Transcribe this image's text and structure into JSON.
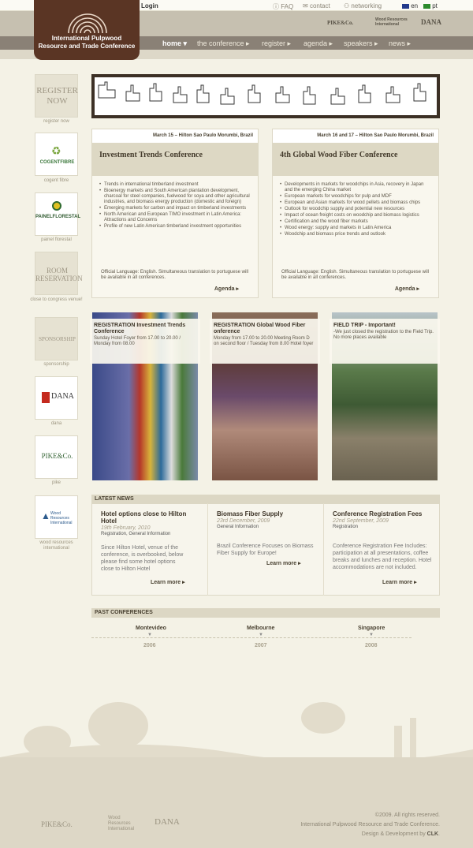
{
  "header": {
    "login": "Login",
    "faq": "FAQ",
    "contact": "contact",
    "networking": "networking",
    "lang_en": "en",
    "lang_pt": "pt",
    "logo_line1": "International Pulpwood",
    "logo_line2": "Resource and Trade Conference",
    "partner_logos": [
      "PIKE&Co.",
      "Wood Resources International",
      "DANA"
    ]
  },
  "nav": {
    "items": [
      "home",
      "the conference",
      "register",
      "agenda",
      "speakers",
      "news"
    ]
  },
  "sidebar": {
    "register_big": "REGISTER NOW",
    "register_cap": "register now",
    "cogent": "COGENTFIBRE",
    "cogent_cap": "cogent fibre",
    "painel": "PAINELFLORESTAL",
    "painel_cap": "painel florestal",
    "room_big": "ROOM RESERVATION",
    "room_cap": "close to congress venue!",
    "sponsor_big": "SPONSORSHIP",
    "sponsor_cap": "sponsorship",
    "dana": "DANA",
    "dana_cap": "dana",
    "pike": "PIKE&Co.",
    "pike_cap": "pike",
    "wri": "Wood Resources International",
    "wri_cap": "wood resources international"
  },
  "conferences": [
    {
      "date": "March 15 – Hilton Sao Paulo Morumbi, Brazil",
      "title": "Investment Trends Conference",
      "bullets": [
        "Trends in international timberland investment",
        "Bioenergy markets and South American plantation development, charcoal for steel companies, fuelwood for soya and other agricultural industries, and biomass energy production (domestic and foreign)",
        "Emerging markets for carbon and impact on timberland investments",
        "North American and European TIMO investment in Latin America: Attractions and Concerns",
        "Profile of new Latin American timberland investment opportunities"
      ],
      "lang": "Official Language: English. Simultaneous translation to portuguese will be available in all conferences.",
      "agenda": "Agenda"
    },
    {
      "date": "March 16 and 17 – Hilton Sao Paulo Morumbi, Brazil",
      "title": "4th Global Wood Fiber Conference",
      "bullets": [
        "Developments in markets for woodchips in Asia, recovery in Japan and the emerging China market",
        "European markets for woodchips for pulp and MDF",
        "European and Asian markets for wood pellets and biomass chips",
        "Outlook for woodchip supply and potential new resources",
        "Impact of ocean freight costs on woodchip and biomass logistics",
        "Certification and the wood fiber markets",
        "Wood energy: supply and markets in Latin America",
        "Woodchip and biomass price trends and outlook"
      ],
      "lang": "Official Language: English. Simultaneous translation to portuguese will be available in all conferences.",
      "agenda": "Agenda"
    }
  ],
  "tiles": [
    {
      "title": "REGISTRATION Investment Trends Conference",
      "sub": "Sunday Hotel Foyer from 17.00 to 20.00 / Monday from 08.00"
    },
    {
      "title": "REGISTRATION Global Wood Fiber onference",
      "sub": "Monday from 17.00 to 20.00 Meeting Room D on second floor / Tuesday from 8.00 Hotel foyer"
    },
    {
      "title": "FIELD TRIP - Important!",
      "sub": "-We just closed the registration to the Field Trip. No more places available"
    }
  ],
  "news": {
    "heading": "LATEST NEWS",
    "items": [
      {
        "title": "Hotel options close to Hilton Hotel",
        "date": "19th February, 2010",
        "cat": "Registration, General Information",
        "text": "Since Hilton Hotel, venue of the conference, is overbooked, below please find some hotel options close to Hilton Hotel",
        "more": "Learn more"
      },
      {
        "title": "Biomass Fiber Supply",
        "date": "23rd December, 2009",
        "cat": "General Information",
        "text": "Brazil Conference Focuses on Biomass Fiber Supply for Europe!",
        "more": "Learn more"
      },
      {
        "title": "Conference Registration Fees",
        "date": "22nd September, 2009",
        "cat": "Registration",
        "text": "Conference Registration Fee Includes: participation at all presentations, coffee breaks and lunches and reception. Hotel accommodations are not included.",
        "more": "Learn more"
      }
    ]
  },
  "past": {
    "heading": "PAST CONFERENCES",
    "items": [
      {
        "city": "Montevideo",
        "year": "2006"
      },
      {
        "city": "Melbourne",
        "year": "2007"
      },
      {
        "city": "Singapore",
        "year": "2008"
      }
    ]
  },
  "footer": {
    "copy": "©2009. All rights reserved.",
    "org": "International Pulpwood Resource and Trade Conference.",
    "design": "Design & Development by",
    "clk": "CLK",
    "logos": [
      "PIKE&Co.",
      "Wood Resources International",
      "DANA"
    ]
  }
}
